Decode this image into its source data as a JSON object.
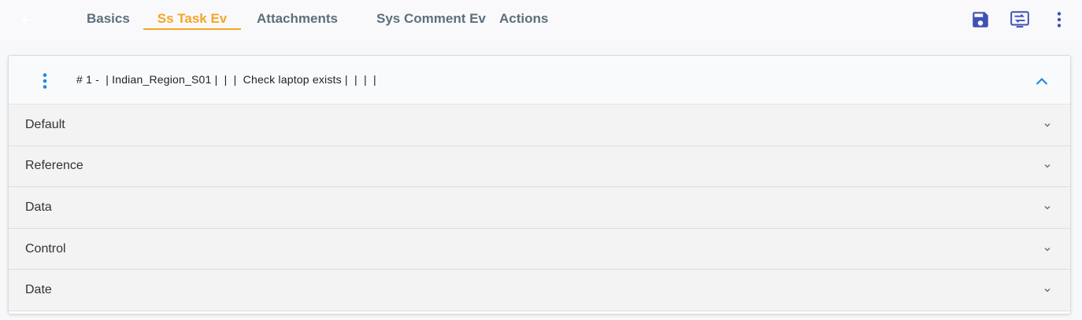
{
  "toolbar": {
    "back_icon": "arrow-left-icon",
    "tabs": [
      {
        "label": "Basics",
        "active": false
      },
      {
        "label": "Ss Task Ev",
        "active": true
      },
      {
        "label": "Attachments",
        "active": false
      },
      {
        "label": "Sys Comment Ev",
        "active": false
      },
      {
        "label": "Actions",
        "active": false
      }
    ],
    "actions": [
      {
        "icon": "save-icon"
      },
      {
        "icon": "transfer-icon"
      },
      {
        "icon": "more-vertical-icon"
      }
    ]
  },
  "record": {
    "title": "# 1 -  | Indian_Region_S01 |  |  |  Check laptop exists |  |  |  |",
    "menu_icon": "more-vertical-icon",
    "collapse_icon": "chevron-up-icon"
  },
  "sections": [
    {
      "label": "Default"
    },
    {
      "label": "Reference"
    },
    {
      "label": "Data"
    },
    {
      "label": "Control"
    },
    {
      "label": "Date"
    }
  ],
  "colors": {
    "accent": "#f5a623",
    "primary": "#3f51b5",
    "link_blue": "#1e88e5",
    "tab_text": "#5d6f7c"
  }
}
